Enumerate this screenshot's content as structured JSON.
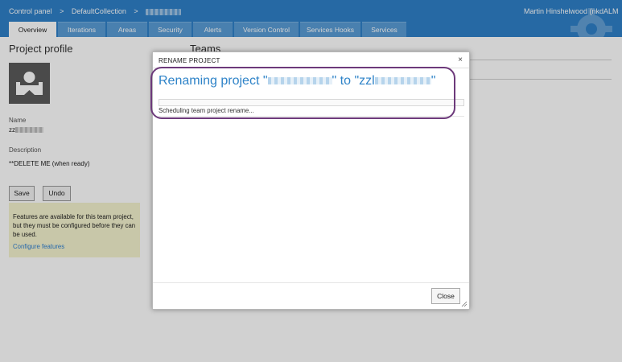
{
  "breadcrumb": {
    "items": [
      "Control panel",
      "DefaultCollection"
    ],
    "separator": ">"
  },
  "user": {
    "name": "Martin Hinshelwood (nkdALM",
    "menu_icon": "chevron-down-icon"
  },
  "tabs": [
    {
      "label": "Overview",
      "active": true
    },
    {
      "label": "Iterations",
      "active": false
    },
    {
      "label": "Areas",
      "active": false
    },
    {
      "label": "Security",
      "active": false
    },
    {
      "label": "Alerts",
      "active": false
    },
    {
      "label": "Version Control",
      "active": false
    },
    {
      "label": "Services Hooks",
      "active": false
    },
    {
      "label": "Services",
      "active": false
    }
  ],
  "project": {
    "title": "Project profile",
    "name_label": "Name",
    "name_value": "zz",
    "description_label": "Description",
    "description_value": "**DELETE ME (when ready)",
    "save_label": "Save",
    "undo_label": "Undo",
    "features_text": "Features are available for this team project, but they must be configured before they can be used.",
    "features_link": "Configure features"
  },
  "teams": {
    "title": "Teams"
  },
  "modal": {
    "title": "RENAME PROJECT",
    "close_glyph": "×",
    "heading_prefix": "Renaming project \"",
    "heading_middle": "\" to \"zzl",
    "heading_suffix": "\"",
    "status": "Scheduling team project rename...",
    "progress": 0,
    "close_label": "Close"
  },
  "colors": {
    "header": "#2f80c9",
    "accent": "#2e83c8",
    "highlight": "#6d3a7b",
    "feature_bg": "#f5f3cf"
  }
}
